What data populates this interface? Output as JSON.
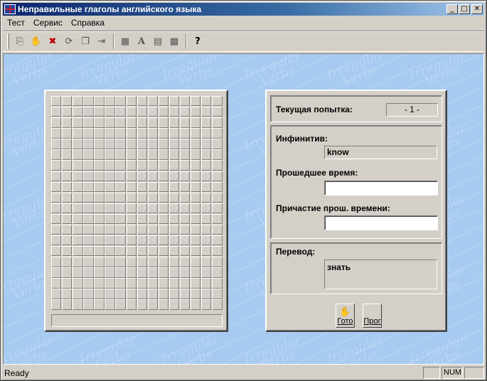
{
  "window": {
    "title": "Неправильные глаголы английского языка",
    "controls": {
      "minimize": "_",
      "maximize": "□",
      "close": "✕"
    }
  },
  "menu": {
    "items": [
      "Тест",
      "Сервис",
      "Справка"
    ]
  },
  "toolbar": {
    "icons": [
      "open-icon",
      "hand-icon",
      "stop-icon",
      "refresh-icon",
      "copy-icon",
      "exit-icon",
      "grid-icon",
      "font-icon",
      "print-icon",
      "settings-icon",
      "help-icon"
    ],
    "help_glyph": "?"
  },
  "background": {
    "watermark_line1": "Irregular",
    "watermark_line2": "Verbs"
  },
  "test": {
    "attempt_label": "Текущая попытка:",
    "attempt_value": "- 1 -",
    "infinitive_label": "Инфинитив:",
    "infinitive_value": "know",
    "past_label": "Прошедшее время:",
    "past_value": "",
    "participle_label": "Причастие прош. времени:",
    "participle_value": "",
    "translation_label": "Перевод:",
    "translation_value": "знать",
    "ready_button": "Гото",
    "skip_button": "Прог"
  },
  "status": {
    "text": "Ready",
    "num": "NUM"
  },
  "colors": {
    "workspace": "#a6caf0",
    "titlebar": "#0a246a",
    "face": "#d4d0c8"
  }
}
